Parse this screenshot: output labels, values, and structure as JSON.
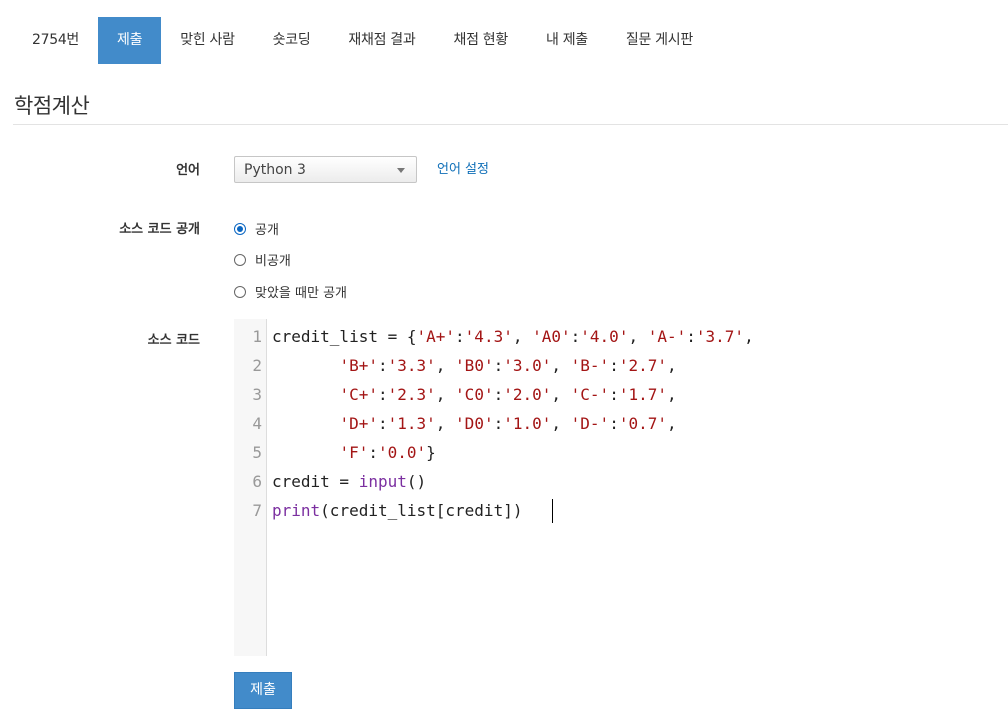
{
  "tabs": [
    {
      "label": "2754번",
      "active": false
    },
    {
      "label": "제출",
      "active": true
    },
    {
      "label": "맞힌 사람",
      "active": false
    },
    {
      "label": "숏코딩",
      "active": false
    },
    {
      "label": "재채점 결과",
      "active": false
    },
    {
      "label": "채점 현황",
      "active": false
    },
    {
      "label": "내 제출",
      "active": false
    },
    {
      "label": "질문 게시판",
      "active": false
    }
  ],
  "page_title": "학점계산",
  "form": {
    "language_label": "언어",
    "language_selected": "Python 3",
    "language_settings_link": "언어 설정",
    "visibility_label": "소스 코드 공개",
    "visibility_options": [
      {
        "label": "공개",
        "checked": true
      },
      {
        "label": "비공개",
        "checked": false
      },
      {
        "label": "맞았을 때만 공개",
        "checked": false
      }
    ],
    "source_label": "소스 코드",
    "submit_label": "제출"
  },
  "editor": {
    "lines": [
      {
        "n": "1",
        "tokens": [
          {
            "t": "credit_list = {"
          },
          {
            "t": "'A+'",
            "c": "s"
          },
          {
            "t": ":"
          },
          {
            "t": "'4.3'",
            "c": "s"
          },
          {
            "t": ", "
          },
          {
            "t": "'A0'",
            "c": "s"
          },
          {
            "t": ":"
          },
          {
            "t": "'4.0'",
            "c": "s"
          },
          {
            "t": ", "
          },
          {
            "t": "'A-'",
            "c": "s"
          },
          {
            "t": ":"
          },
          {
            "t": "'3.7'",
            "c": "s"
          },
          {
            "t": ","
          }
        ]
      },
      {
        "n": "2",
        "tokens": [
          {
            "t": "       "
          },
          {
            "t": "'B+'",
            "c": "s"
          },
          {
            "t": ":"
          },
          {
            "t": "'3.3'",
            "c": "s"
          },
          {
            "t": ", "
          },
          {
            "t": "'B0'",
            "c": "s"
          },
          {
            "t": ":"
          },
          {
            "t": "'3.0'",
            "c": "s"
          },
          {
            "t": ", "
          },
          {
            "t": "'B-'",
            "c": "s"
          },
          {
            "t": ":"
          },
          {
            "t": "'2.7'",
            "c": "s"
          },
          {
            "t": ","
          }
        ]
      },
      {
        "n": "3",
        "tokens": [
          {
            "t": "       "
          },
          {
            "t": "'C+'",
            "c": "s"
          },
          {
            "t": ":"
          },
          {
            "t": "'2.3'",
            "c": "s"
          },
          {
            "t": ", "
          },
          {
            "t": "'C0'",
            "c": "s"
          },
          {
            "t": ":"
          },
          {
            "t": "'2.0'",
            "c": "s"
          },
          {
            "t": ", "
          },
          {
            "t": "'C-'",
            "c": "s"
          },
          {
            "t": ":"
          },
          {
            "t": "'1.7'",
            "c": "s"
          },
          {
            "t": ","
          }
        ]
      },
      {
        "n": "4",
        "tokens": [
          {
            "t": "       "
          },
          {
            "t": "'D+'",
            "c": "s"
          },
          {
            "t": ":"
          },
          {
            "t": "'1.3'",
            "c": "s"
          },
          {
            "t": ", "
          },
          {
            "t": "'D0'",
            "c": "s"
          },
          {
            "t": ":"
          },
          {
            "t": "'1.0'",
            "c": "s"
          },
          {
            "t": ", "
          },
          {
            "t": "'D-'",
            "c": "s"
          },
          {
            "t": ":"
          },
          {
            "t": "'0.7'",
            "c": "s"
          },
          {
            "t": ","
          }
        ]
      },
      {
        "n": "5",
        "tokens": [
          {
            "t": "       "
          },
          {
            "t": "'F'",
            "c": "s"
          },
          {
            "t": ":"
          },
          {
            "t": "'0.0'",
            "c": "s"
          },
          {
            "t": "}"
          }
        ]
      },
      {
        "n": "6",
        "tokens": [
          {
            "t": "credit = "
          },
          {
            "t": "input",
            "c": "k"
          },
          {
            "t": "()"
          }
        ]
      },
      {
        "n": "7",
        "tokens": [
          {
            "t": "print",
            "c": "k"
          },
          {
            "t": "(credit_list[credit])"
          }
        ]
      }
    ]
  },
  "colors": {
    "accent": "#428bca",
    "link": "#0f6fb8",
    "string": "#a31515",
    "builtin": "#7b2fa0"
  }
}
